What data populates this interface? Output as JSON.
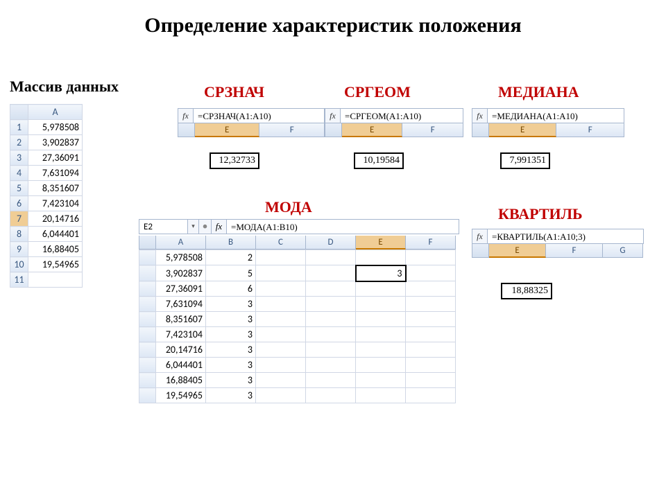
{
  "title": "Определение характеристик положения",
  "subtitle": "Массив данных",
  "data_array": {
    "col_header": "A",
    "rows": [
      "5,978508",
      "3,902837",
      "27,36091",
      "7,631094",
      "8,351607",
      "7,423104",
      "20,14716",
      "6,044401",
      "16,88405",
      "19,54965"
    ],
    "extra_row": "11",
    "selected_row": 7
  },
  "blocks": {
    "srznach": {
      "title": "СРЗНАЧ",
      "formula": "=СРЗНАЧ(A1:A10)",
      "cols": [
        "E",
        "F"
      ],
      "sel_col": "E",
      "result": "12,32733"
    },
    "srgeom": {
      "title": "СРГЕОМ",
      "formula": "=СРГЕОМ(A1:A10)",
      "cols": [
        "E",
        "F"
      ],
      "sel_col": "E",
      "result": "10,19584"
    },
    "mediana": {
      "title": "МЕДИАНА",
      "formula": "=МЕДИАНА(A1:A10)",
      "cols": [
        "E",
        "F"
      ],
      "sel_col": "E",
      "result": "7,991351"
    },
    "kvartil": {
      "title": "КВАРТИЛЬ",
      "formula": "=КВАРТИЛЬ(A1:A10;3)",
      "cols": [
        "E",
        "F",
        "G"
      ],
      "sel_col": "E",
      "result": "18,88325"
    },
    "moda": {
      "title": "МОДА",
      "namebox": "E2",
      "formula": "=МОДА(A1:B10)",
      "cols": [
        "A",
        "B",
        "C",
        "D",
        "E",
        "F"
      ],
      "sel_col": "E",
      "result": "3",
      "table": [
        {
          "a": "5,978508",
          "b": "2"
        },
        {
          "a": "3,902837",
          "b": "5"
        },
        {
          "a": "27,36091",
          "b": "6"
        },
        {
          "a": "7,631094",
          "b": "3"
        },
        {
          "a": "8,351607",
          "b": "3"
        },
        {
          "a": "7,423104",
          "b": "3"
        },
        {
          "a": "20,14716",
          "b": "3"
        },
        {
          "a": "6,044401",
          "b": "3"
        },
        {
          "a": "16,88405",
          "b": "3"
        },
        {
          "a": "19,54965",
          "b": "3"
        }
      ]
    }
  },
  "fx_label": "fx"
}
